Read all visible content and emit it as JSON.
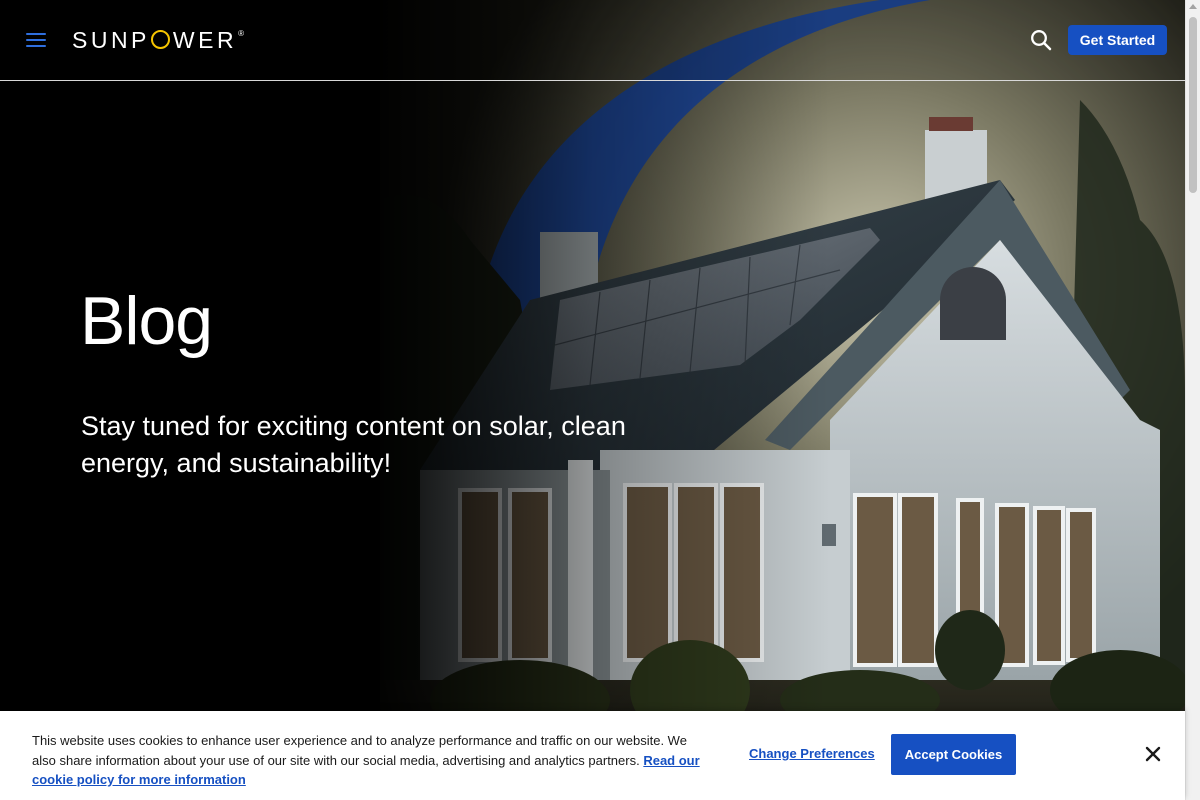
{
  "header": {
    "menu_icon": "hamburger-menu-icon",
    "logo_text_before": "SUNP",
    "logo_text_after": "WER",
    "logo_registered": "®",
    "search_icon": "search-icon",
    "get_started_label": "Get Started"
  },
  "hero": {
    "title": "Blog",
    "subtitle": "Stay tuned for exciting content on solar, clean energy, and sustainability!"
  },
  "cookie_banner": {
    "text": "This website uses cookies to enhance user experience and to analyze performance and traffic on our website. We also share information about your use of our site with our social media, advertising and analytics partners.",
    "policy_link": "Read our cookie policy for more information",
    "change_preferences_label": "Change Preferences",
    "accept_label": "Accept Cookies",
    "close_icon": "close-icon"
  },
  "colors": {
    "brand_blue": "#1650c2",
    "logo_yellow": "#f5c400",
    "menu_blue": "#2f6fde"
  }
}
